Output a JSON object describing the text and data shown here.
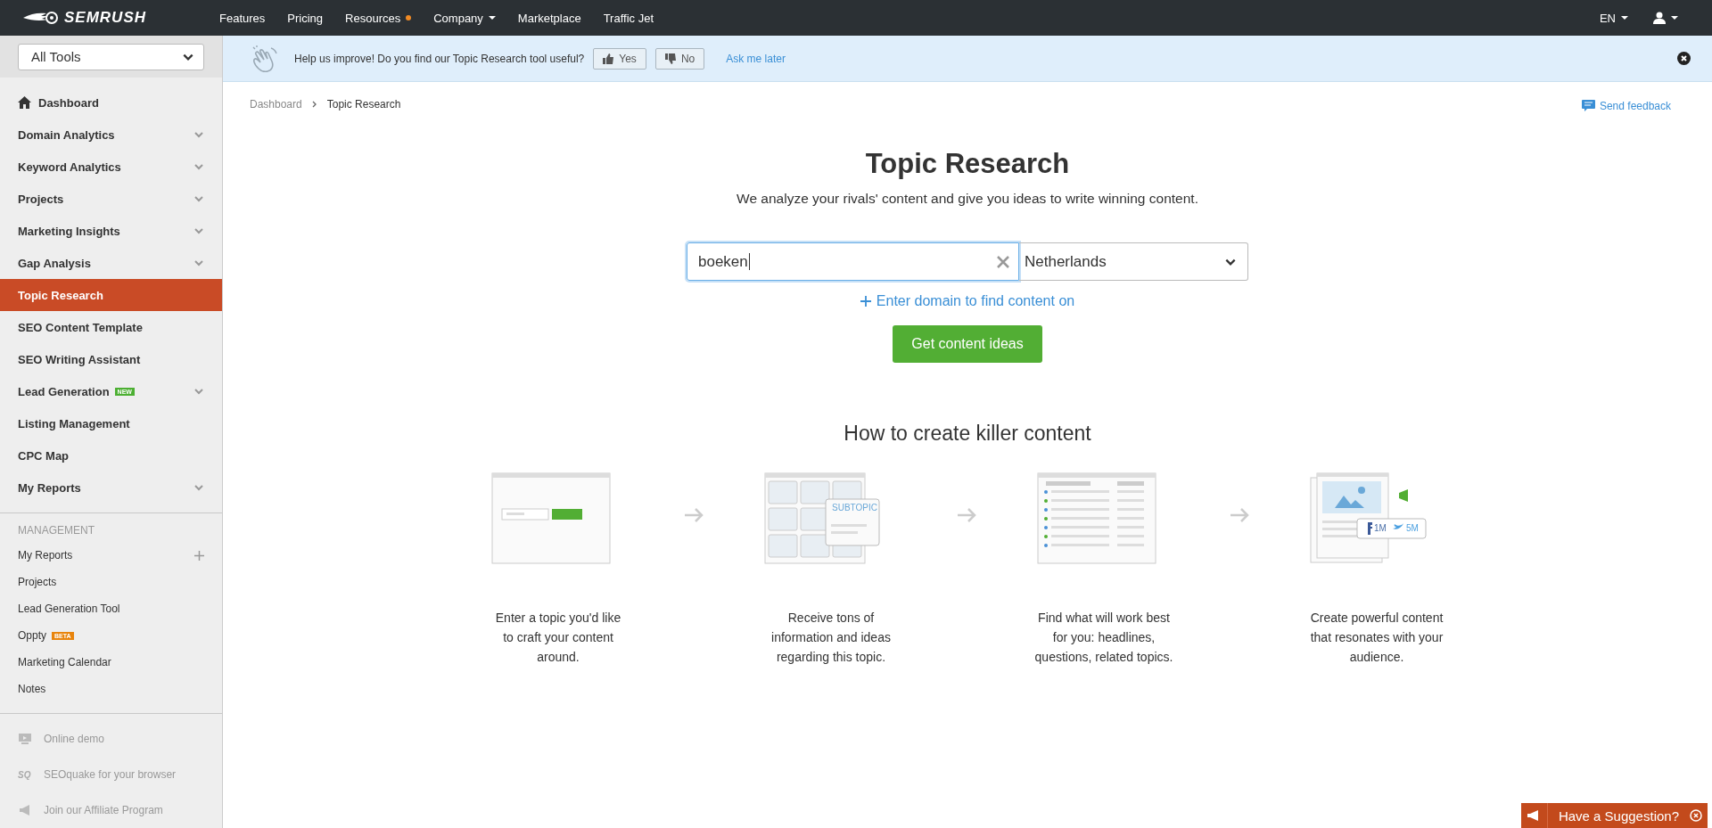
{
  "topbar": {
    "logo": "SEMRUSH",
    "nav": [
      {
        "label": "Features",
        "kind": "plain"
      },
      {
        "label": "Pricing",
        "kind": "plain"
      },
      {
        "label": "Resources",
        "kind": "dot"
      },
      {
        "label": "Company",
        "kind": "dropdown"
      },
      {
        "label": "Marketplace",
        "kind": "plain"
      },
      {
        "label": "Traffic Jet",
        "kind": "plain"
      }
    ],
    "language": "EN"
  },
  "sidebar": {
    "tool_select": "All Tools",
    "items": [
      {
        "label": "Dashboard",
        "kind": "home",
        "selected": false,
        "expandable": false
      },
      {
        "label": "Domain Analytics",
        "kind": "link",
        "selected": false,
        "expandable": true
      },
      {
        "label": "Keyword Analytics",
        "kind": "link",
        "selected": false,
        "expandable": true
      },
      {
        "label": "Projects",
        "kind": "link",
        "selected": false,
        "expandable": true
      },
      {
        "label": "Marketing Insights",
        "kind": "link",
        "selected": false,
        "expandable": true
      },
      {
        "label": "Gap Analysis",
        "kind": "link",
        "selected": false,
        "expandable": true
      },
      {
        "label": "Topic Research",
        "kind": "link",
        "selected": true,
        "expandable": false
      },
      {
        "label": "SEO Content Template",
        "kind": "link",
        "selected": false,
        "expandable": false
      },
      {
        "label": "SEO Writing Assistant",
        "kind": "link",
        "selected": false,
        "expandable": false
      },
      {
        "label": "Lead Generation",
        "kind": "link",
        "selected": false,
        "expandable": true,
        "badge": "NEW",
        "color": "#4caf32"
      },
      {
        "label": "Listing Management",
        "kind": "link",
        "selected": false,
        "expandable": false
      },
      {
        "label": "CPC Map",
        "kind": "link",
        "selected": false,
        "expandable": false
      },
      {
        "label": "My Reports",
        "kind": "link",
        "selected": false,
        "expandable": true
      }
    ],
    "management_heading": "MANAGEMENT",
    "management": [
      {
        "label": "My Reports",
        "addable": true
      },
      {
        "label": "Projects",
        "addable": false
      },
      {
        "label": "Lead Generation Tool",
        "addable": false
      },
      {
        "label": "Oppty",
        "addable": false,
        "badge": "BETA",
        "color": "#e8840c"
      },
      {
        "label": "Marketing Calendar",
        "addable": false
      },
      {
        "label": "Notes",
        "addable": false
      }
    ],
    "footer_links": [
      {
        "label": "Online demo"
      },
      {
        "label": "SEOquake for your browser",
        "icon_text": "SQ"
      },
      {
        "label": "Join our Affiliate Program"
      }
    ]
  },
  "banner": {
    "text": "Help us improve! Do you find our Topic Research tool useful?",
    "yes": "Yes",
    "no": "No",
    "later": "Ask me later"
  },
  "breadcrumb": [
    "Dashboard",
    "Topic Research"
  ],
  "send_feedback": "Send feedback",
  "hero": {
    "title": "Topic Research",
    "subtitle": "We analyze your rivals' content and give you ideas to write winning content.",
    "search_value": "boeken",
    "country": "Netherlands",
    "add_domain": "Enter domain to find content on",
    "button": "Get content ideas"
  },
  "how_to": {
    "title": "How to create killer content",
    "steps": [
      {
        "kind": "search",
        "text": "Enter a topic you'd like\nto craft your content\naround."
      },
      {
        "kind": "subtopic",
        "label": "SUBTOPIC",
        "text": "Receive tons of\ninformation and ideas\nregarding this topic."
      },
      {
        "kind": "list",
        "text": "Find what will work best\nfor you: headlines,\nquestions, related topics."
      },
      {
        "kind": "share",
        "counts": [
          "1M",
          "5M"
        ],
        "text": "Create powerful content\nthat resonates with your\naudience."
      }
    ]
  },
  "suggestion": "Have a Suggestion?"
}
